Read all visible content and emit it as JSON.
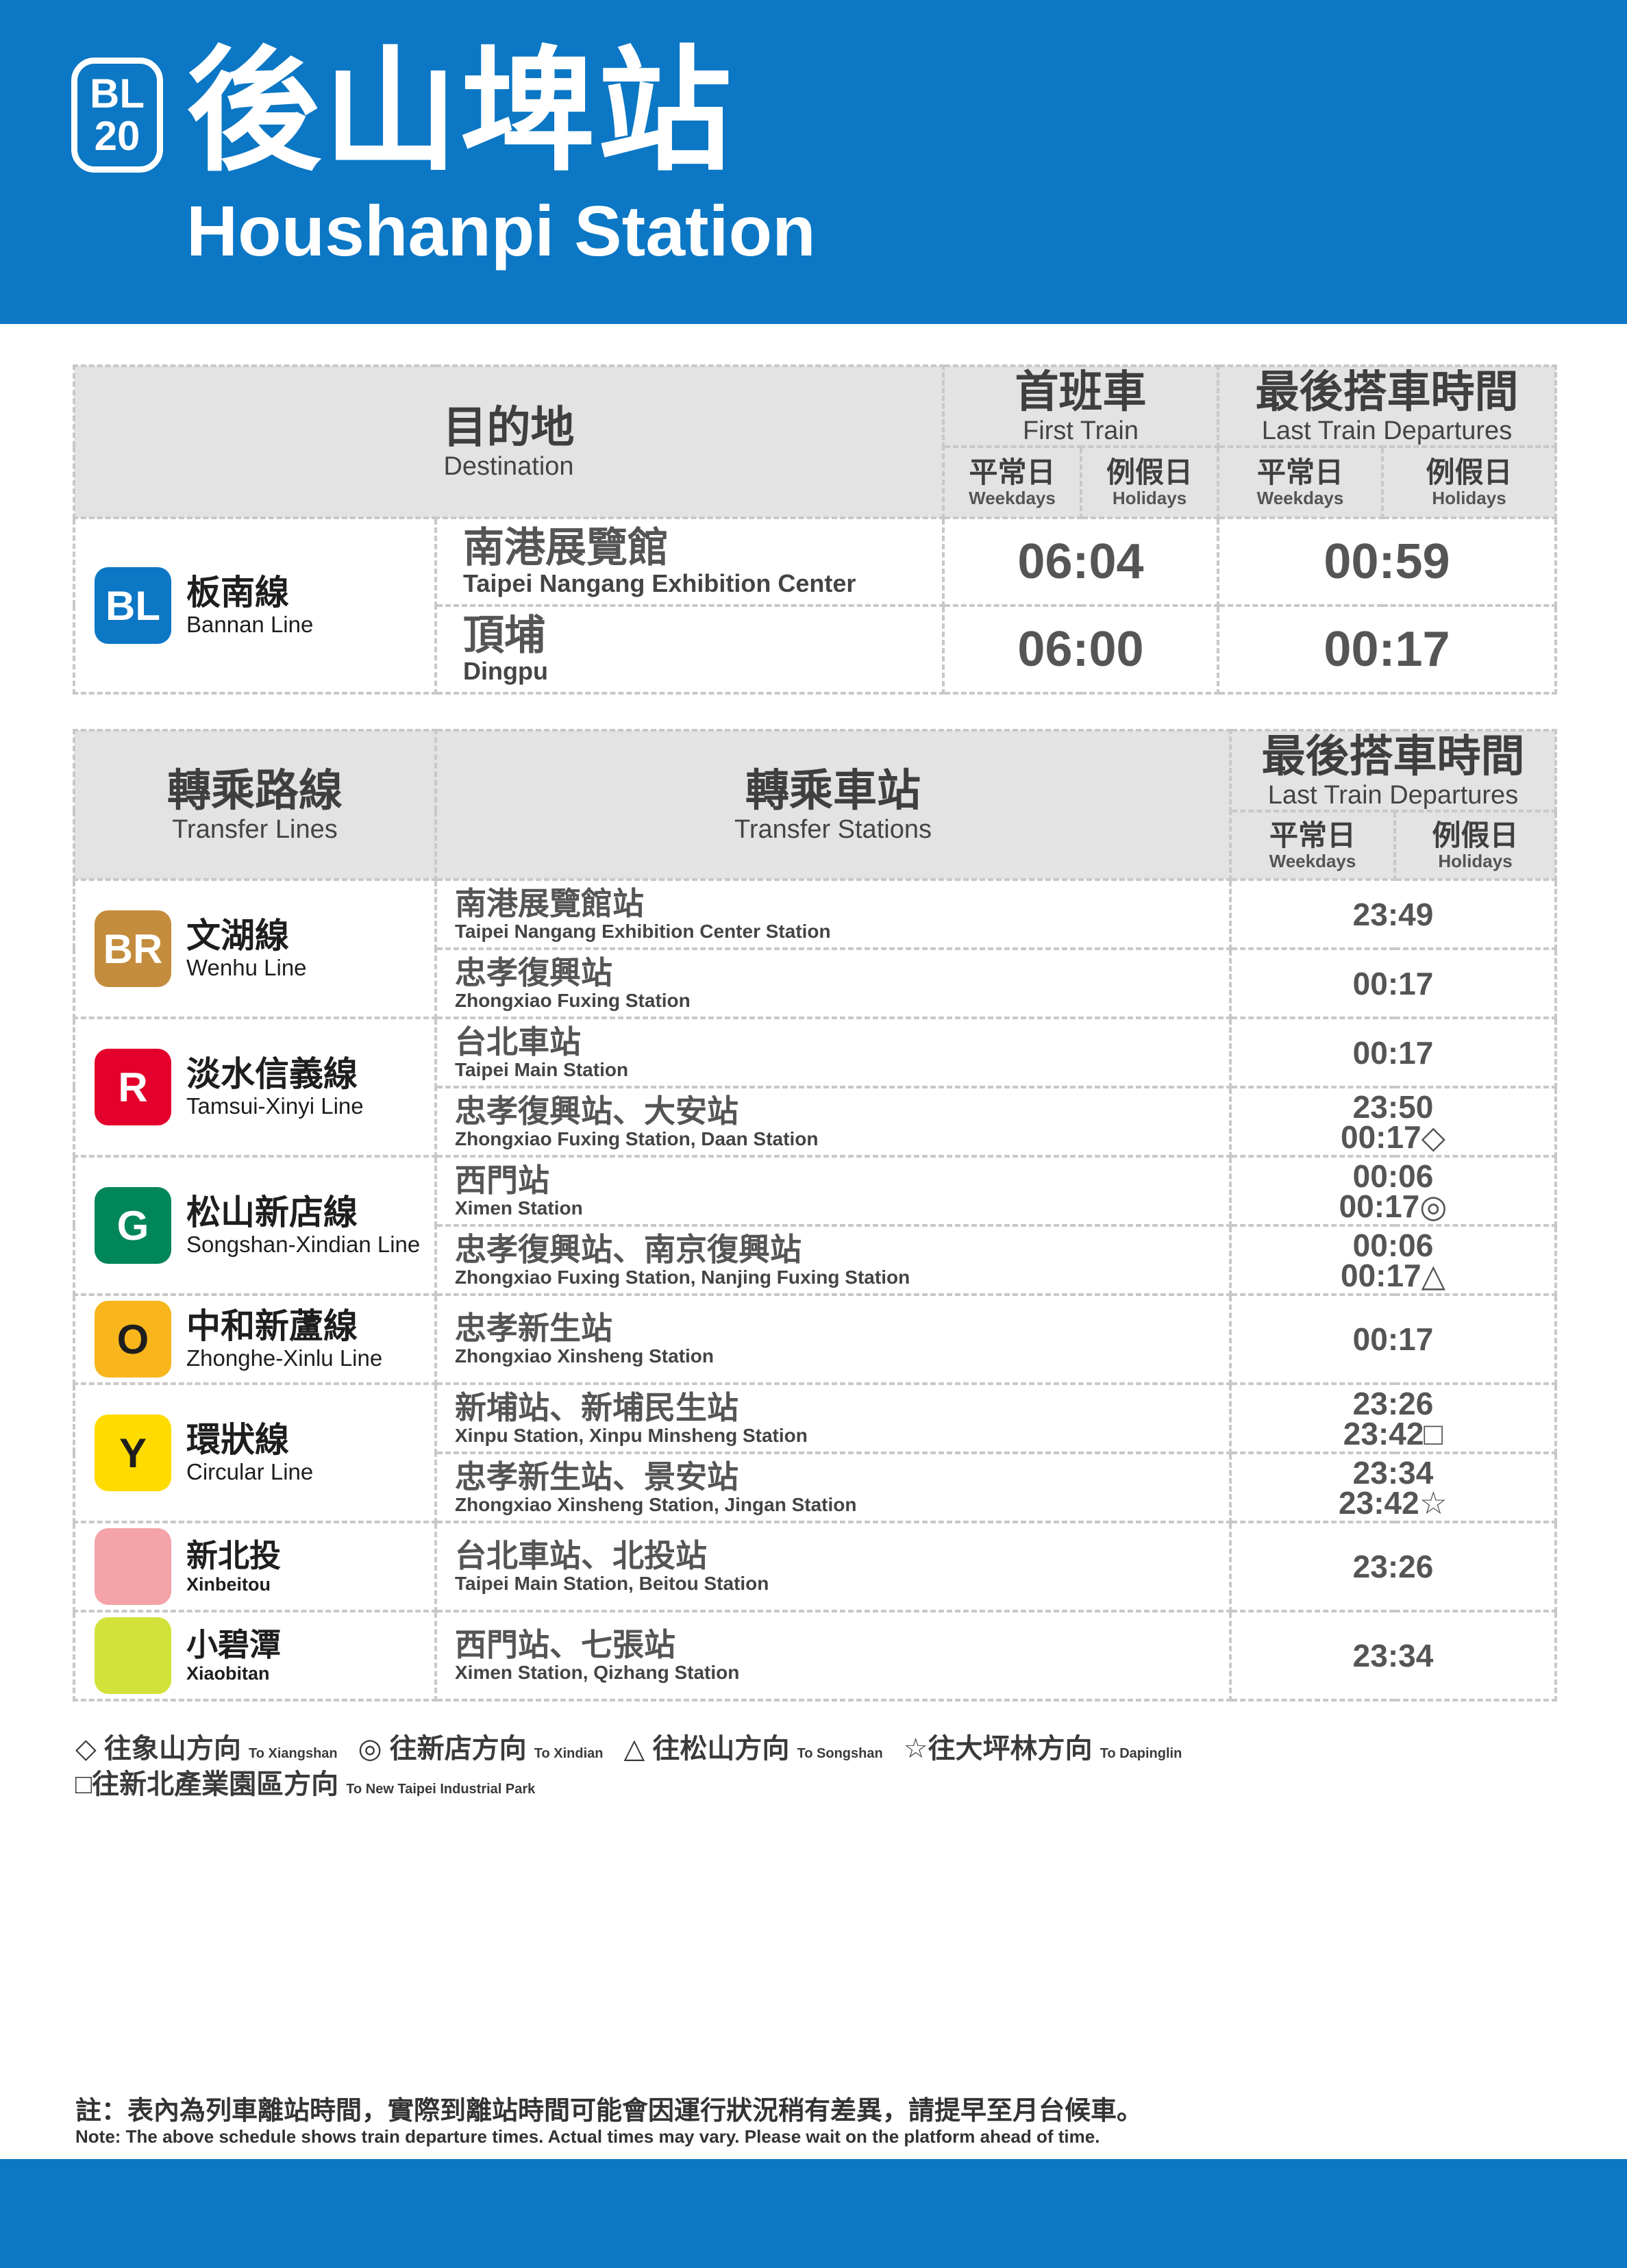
{
  "header": {
    "code_line": "BL",
    "code_num": "20",
    "title_zh": "後山埤站",
    "title_en": "Houshanpi Station"
  },
  "schedule": {
    "dest_zh": "目的地",
    "dest_en": "Destination",
    "first_zh": "首班車",
    "first_en": "First Train",
    "last_zh": "最後搭車時間",
    "last_en": "Last Train Departures",
    "weekdays_zh": "平常日",
    "weekdays_en": "Weekdays",
    "holidays_zh": "例假日",
    "holidays_en": "Holidays",
    "line": {
      "code": "BL",
      "zh": "板南線",
      "en": "Bannan Line",
      "color": "#0b77c5"
    },
    "rows": [
      {
        "zh": "南港展覽館",
        "en": "Taipei Nangang Exhibition Center",
        "first": "06:04",
        "last": "00:59"
      },
      {
        "zh": "頂埔",
        "en": "Dingpu",
        "first": "06:00",
        "last": "00:17"
      }
    ]
  },
  "transfer": {
    "lines_zh": "轉乘路線",
    "lines_en": "Transfer Lines",
    "stations_zh": "轉乘車站",
    "stations_en": "Transfer Stations",
    "last_zh": "最後搭車時間",
    "last_en": "Last Train Departures",
    "weekdays_zh": "平常日",
    "weekdays_en": "Weekdays",
    "holidays_zh": "例假日",
    "holidays_en": "Holidays",
    "lines": [
      {
        "code": "BR",
        "zh": "文湖線",
        "en": "Wenhu Line",
        "color": "#c48c3d",
        "rows": [
          {
            "zh": "南港展覽館站",
            "en": "Taipei Nangang Exhibition Center Station",
            "times": [
              "23:49"
            ]
          },
          {
            "zh": "忠孝復興站",
            "en": "Zhongxiao Fuxing Station",
            "times": [
              "00:17"
            ]
          }
        ]
      },
      {
        "code": "R",
        "zh": "淡水信義線",
        "en": "Tamsui-Xinyi Line",
        "color": "#e3002c",
        "rows": [
          {
            "zh": "台北車站",
            "en": "Taipei Main Station",
            "times": [
              "00:17"
            ]
          },
          {
            "zh": "忠孝復興站、大安站",
            "en": "Zhongxiao Fuxing Station, Daan Station",
            "times": [
              "23:50",
              "00:17◇"
            ]
          }
        ]
      },
      {
        "code": "G",
        "zh": "松山新店線",
        "en": "Songshan-Xindian Line",
        "color": "#008659",
        "rows": [
          {
            "zh": "西門站",
            "en": "Ximen Station",
            "times": [
              "00:06",
              "00:17◎"
            ]
          },
          {
            "zh": "忠孝復興站、南京復興站",
            "en": "Zhongxiao Fuxing Station, Nanjing Fuxing Station",
            "times": [
              "00:06",
              "00:17△"
            ]
          }
        ]
      },
      {
        "code": "O",
        "zh": "中和新蘆線",
        "en": "Zhonghe-Xinlu Line",
        "color": "#f8b61c",
        "text_color": "#1e1e1e",
        "rows": [
          {
            "zh": "忠孝新生站",
            "en": "Zhongxiao Xinsheng Station",
            "times": [
              "00:17"
            ]
          }
        ]
      },
      {
        "code": "Y",
        "zh": "環狀線",
        "en": "Circular Line",
        "color": "#ffdb00",
        "text_color": "#1e1e1e",
        "rows": [
          {
            "zh": "新埔站、新埔民生站",
            "en": "Xinpu Station, Xinpu Minsheng Station",
            "times": [
              "23:26",
              "23:42□"
            ]
          },
          {
            "zh": "忠孝新生站、景安站",
            "en": "Zhongxiao Xinsheng Station, Jingan Station",
            "times": [
              "23:34",
              "23:42☆"
            ]
          }
        ]
      },
      {
        "code": "",
        "zh": "新北投",
        "en": "Xinbeitou",
        "color": "#f4a3a9",
        "small": true,
        "rows": [
          {
            "zh": "台北車站、北投站",
            "en": "Taipei Main Station, Beitou Station",
            "times": [
              "23:26"
            ]
          }
        ]
      },
      {
        "code": "",
        "zh": "小碧潭",
        "en": "Xiaobitan",
        "color": "#d3e23a",
        "small": true,
        "rows": [
          {
            "zh": "西門站、七張站",
            "en": "Ximen Station, Qizhang Station",
            "times": [
              "23:34"
            ]
          }
        ]
      }
    ]
  },
  "legend": {
    "row1": [
      {
        "zh": "◇ 往象山方向",
        "en": "To Xiangshan"
      },
      {
        "zh": "◎ 往新店方向",
        "en": "To Xindian"
      },
      {
        "zh": "△ 往松山方向",
        "en": "To Songshan"
      },
      {
        "zh": "☆往大坪林方向",
        "en": "To Dapinglin"
      }
    ],
    "row2": [
      {
        "zh": "□往新北產業園區方向",
        "en": "To New Taipei Industrial Park"
      }
    ]
  },
  "note": {
    "zh": "註：表內為列車離站時間，實際到離站時間可能會因運行狀況稍有差異，請提早至月台候車。",
    "en": "Note: The above schedule shows train departure times. Actual times may vary. Please wait on the platform ahead of time."
  }
}
